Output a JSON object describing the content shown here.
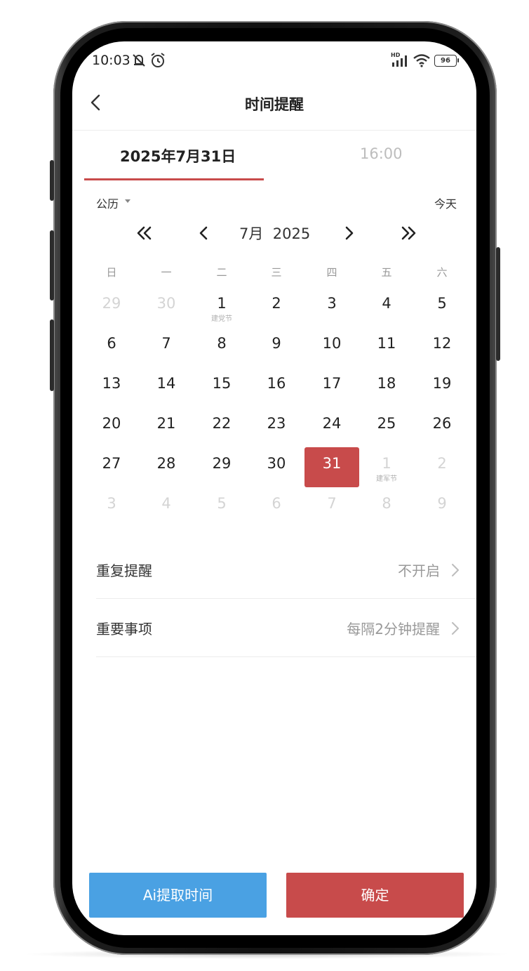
{
  "status_bar": {
    "time": "10:03",
    "battery": "96",
    "network": "HD",
    "icons": [
      "mute-icon",
      "alarm-icon",
      "signal-icon",
      "wifi-icon",
      "battery-icon"
    ]
  },
  "header": {
    "title": "时间提醒",
    "back_icon": "chevron-left-icon"
  },
  "tabs": [
    {
      "label": "2025年7月31日",
      "active": true
    },
    {
      "label": "16:00",
      "active": false
    }
  ],
  "colors": {
    "accent": "#c84b4b",
    "ai_button": "#4aa1e3"
  },
  "calendar": {
    "type_label": "公历",
    "today_label": "今天",
    "month_label": "7月",
    "year_label": "2025",
    "weekdays": [
      "日",
      "一",
      "二",
      "三",
      "四",
      "五",
      "六"
    ],
    "weeks": [
      [
        {
          "d": "29",
          "dim": true
        },
        {
          "d": "30",
          "dim": true
        },
        {
          "d": "1",
          "sub": "建党节"
        },
        {
          "d": "2"
        },
        {
          "d": "3"
        },
        {
          "d": "4"
        },
        {
          "d": "5"
        }
      ],
      [
        {
          "d": "6"
        },
        {
          "d": "7"
        },
        {
          "d": "8"
        },
        {
          "d": "9"
        },
        {
          "d": "10"
        },
        {
          "d": "11"
        },
        {
          "d": "12"
        }
      ],
      [
        {
          "d": "13"
        },
        {
          "d": "14"
        },
        {
          "d": "15"
        },
        {
          "d": "16"
        },
        {
          "d": "17"
        },
        {
          "d": "18"
        },
        {
          "d": "19"
        }
      ],
      [
        {
          "d": "20"
        },
        {
          "d": "21"
        },
        {
          "d": "22"
        },
        {
          "d": "23"
        },
        {
          "d": "24"
        },
        {
          "d": "25"
        },
        {
          "d": "26"
        }
      ],
      [
        {
          "d": "27"
        },
        {
          "d": "28"
        },
        {
          "d": "29"
        },
        {
          "d": "30"
        },
        {
          "d": "31",
          "selected": true
        },
        {
          "d": "1",
          "dim": true,
          "sub": "建军节"
        },
        {
          "d": "2",
          "dim": true
        }
      ],
      [
        {
          "d": "3",
          "dim": true
        },
        {
          "d": "4",
          "dim": true
        },
        {
          "d": "5",
          "dim": true
        },
        {
          "d": "6",
          "dim": true
        },
        {
          "d": "7",
          "dim": true
        },
        {
          "d": "8",
          "dim": true
        },
        {
          "d": "9",
          "dim": true
        }
      ]
    ]
  },
  "settings": [
    {
      "label": "重复提醒",
      "value": "不开启"
    },
    {
      "label": "重要事项",
      "value": "每隔2分钟提醒"
    }
  ],
  "buttons": {
    "ai_label": "Ai提取时间",
    "confirm_label": "确定"
  }
}
